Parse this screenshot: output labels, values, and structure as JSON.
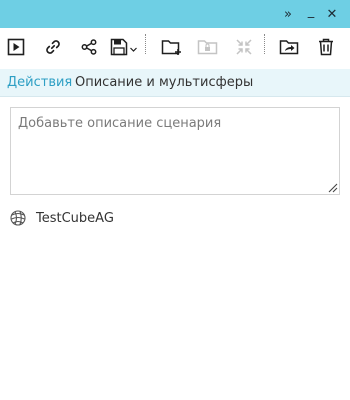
{
  "window": {
    "controls": {
      "expand_icon": "double-chevron-right-icon",
      "minimize_icon": "minimize-icon",
      "close_icon": "close-icon",
      "expand_glyph": "»",
      "minimize_glyph": "_",
      "close_glyph": "✕"
    }
  },
  "toolbar": {
    "items": [
      {
        "name": "play-button",
        "icon": "play-icon",
        "enabled": true
      },
      {
        "name": "link-button",
        "icon": "link-icon",
        "enabled": true
      },
      {
        "name": "share-button",
        "icon": "share-icon",
        "enabled": true
      },
      {
        "name": "save-dropdown-button",
        "icon": "floppy-disk-icon",
        "enabled": true
      },
      {
        "name": "new-folder-button",
        "icon": "folder-plus-icon",
        "enabled": true
      },
      {
        "name": "locked-folder-button",
        "icon": "folder-lock-icon",
        "enabled": false
      },
      {
        "name": "collapse-button",
        "icon": "collapse-arrows-icon",
        "enabled": false
      },
      {
        "name": "move-to-folder-button",
        "icon": "folder-arrow-icon",
        "enabled": true
      },
      {
        "name": "delete-button",
        "icon": "trash-icon",
        "enabled": true
      }
    ],
    "colors": {
      "enabled": "#1f1f1f",
      "disabled": "#c4c4c4"
    }
  },
  "tabs": [
    {
      "label": "Действия",
      "active": true
    },
    {
      "label": "Описание и мультисферы",
      "active": false
    }
  ],
  "description": {
    "placeholder": "Добавьте описание сценария",
    "value": ""
  },
  "scenario": {
    "icon": "cube-icon",
    "label": "TestCubeAG"
  },
  "colors": {
    "titlebar": "#6ecfe4",
    "tabbar": "#e8f6fa",
    "active_tab": "#2d9fc4",
    "text": "#333333"
  }
}
